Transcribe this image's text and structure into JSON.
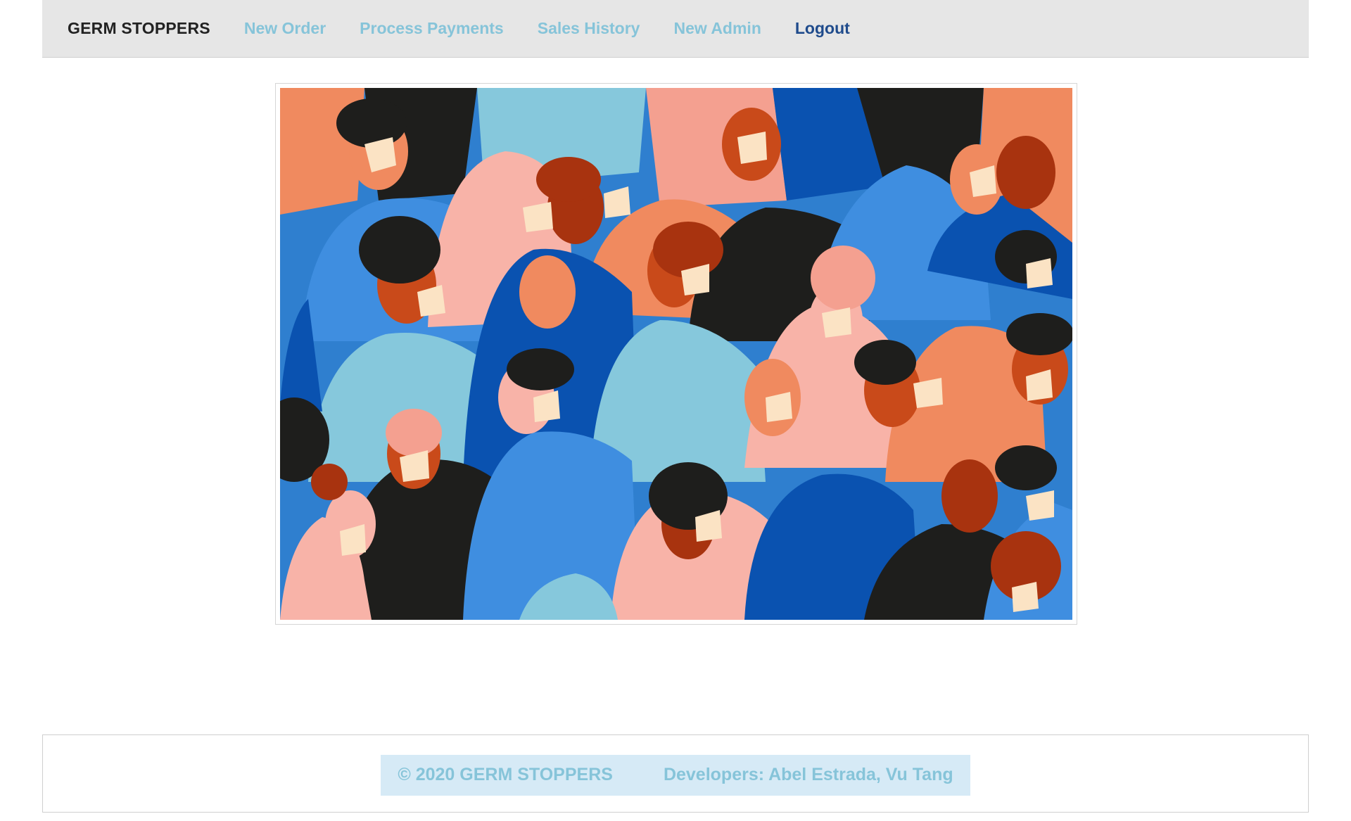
{
  "nav": {
    "brand": "GERM STOPPERS",
    "links": [
      {
        "label": "New Order"
      },
      {
        "label": "Process Payments"
      },
      {
        "label": "Sales History"
      },
      {
        "label": "New Admin"
      },
      {
        "label": "Logout"
      }
    ]
  },
  "colors": {
    "nav_link": "#86c4d9",
    "logout_link": "#1f4b8c",
    "footer_bg": "#d6eaf6",
    "navbar_bg": "#e6e6e6"
  },
  "footer": {
    "copyright": "© 2020 GERM STOPPERS",
    "developers": "Developers: Abel Estrada, Vu Tang"
  }
}
